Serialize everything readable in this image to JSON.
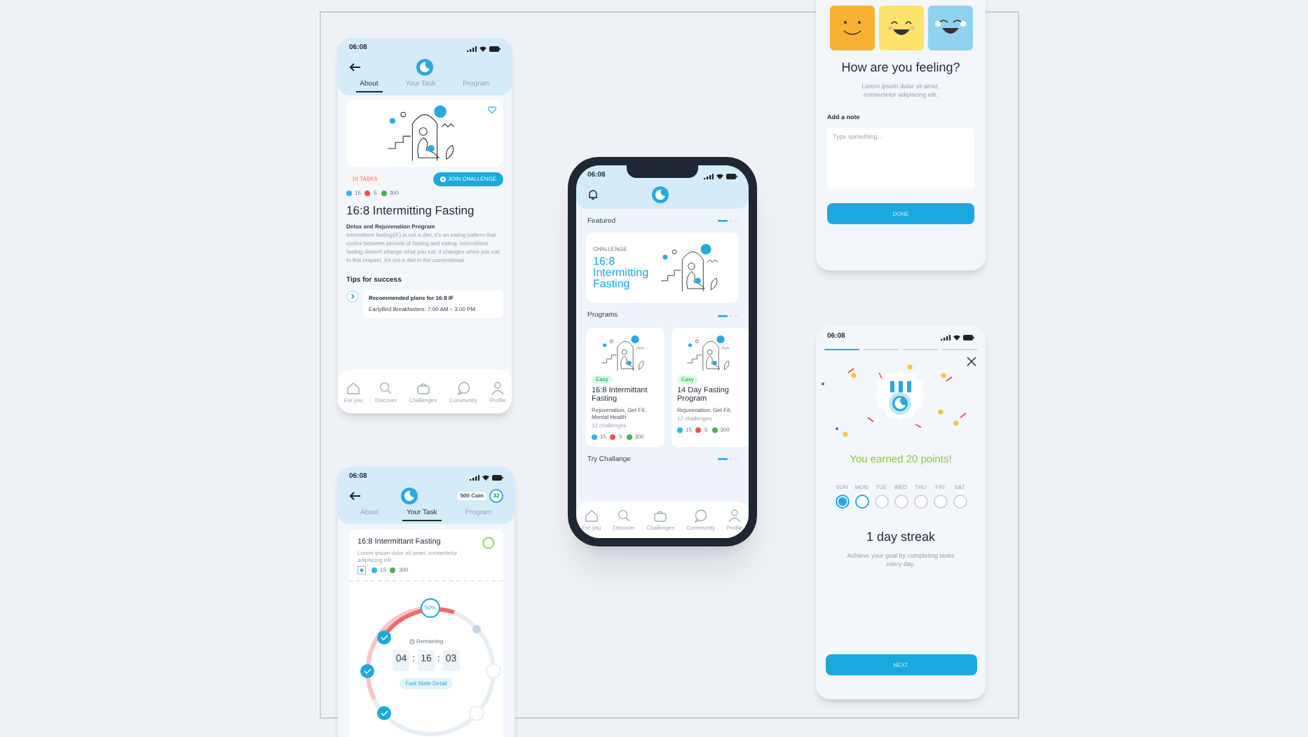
{
  "about_screen": {
    "time": "06:08",
    "tabs": [
      {
        "label": "About",
        "selected": true
      },
      {
        "label": "Your Task",
        "selected": false
      },
      {
        "label": "Program",
        "selected": false
      }
    ],
    "tag": "10 TASKS",
    "join_button": "JOIN CHALLENGE",
    "stats": [
      {
        "value": "15",
        "color": "#35b3e6"
      },
      {
        "value": "5",
        "color": "#ef5350"
      },
      {
        "value": "300",
        "color": "#4caf50"
      }
    ],
    "title": "16:8 Intermitting Fasting",
    "subtitle": "Detox and Rejuvenation Program",
    "description": [
      "Intermittent fasting(IF) is not a diet, it's an eating pattern that cycles between periods of fasting and eating. Intermittent fasting doesn't change what you eat, it changes when you eat.",
      "In this respect, it's not a diet in the conventional"
    ],
    "tips_heading": "Tips for success",
    "tip_title": "Recommended plans for 16:8 IF",
    "tip_line": "EarlyBird Breakfasters: 7:00 AM – 3:00 PM",
    "nav": [
      "For you",
      "Discover",
      "Challenges",
      "Community",
      "Profile"
    ]
  },
  "task_screen": {
    "time": "06:08",
    "coins": "500 Coin",
    "badge": "32",
    "tabs": [
      {
        "label": "About",
        "selected": false
      },
      {
        "label": "Your Task",
        "selected": true
      },
      {
        "label": "Program",
        "selected": false
      }
    ],
    "card_title": "16:8 Intermittant Fasting",
    "card_description": "Lorem ipsum dolor sit amet, consectetur adipiscing elit.",
    "stats": [
      {
        "value": "15",
        "color": "#35b3e6"
      },
      {
        "value": "300",
        "color": "#4caf50"
      }
    ],
    "progress_label": "50%",
    "remaining": "Remaining",
    "timer": [
      "04",
      "16",
      "03"
    ],
    "timer_separator": ":",
    "detail_button": "Fast State Detail"
  },
  "home_screen": {
    "time": "06:08",
    "featured_heading": "Featured",
    "featured_label": "CHALLENGE",
    "featured_title": "16:8 Intermitting Fasting",
    "programs_heading": "Programs",
    "programs": [
      {
        "tag": "Easy",
        "title": "16:8 Intermittant Fasting",
        "topics": "Rejuvenation, Get Fit, Mental Health",
        "count": "12 challenges",
        "stats": [
          {
            "value": "15",
            "color": "#35b3e6"
          },
          {
            "value": "5",
            "color": "#ef5350"
          },
          {
            "value": "300",
            "color": "#4caf50"
          }
        ]
      },
      {
        "tag": "Easy",
        "title": "14 Day Fasting Program",
        "topics": "Rejuvenation, Get Fit,",
        "count": "12 challenges",
        "stats": [
          {
            "value": "15",
            "color": "#35b3e6"
          },
          {
            "value": "5",
            "color": "#ef5350"
          },
          {
            "value": "300",
            "color": "#4caf50"
          }
        ]
      }
    ],
    "try_heading": "Try Challange",
    "nav": [
      "For you",
      "Discover",
      "Challenges",
      "Community",
      "Profile"
    ]
  },
  "mood_screen": {
    "faces": [
      {
        "kind": "smile",
        "color": "#f8b133"
      },
      {
        "kind": "grin",
        "color": "#fde36b"
      },
      {
        "kind": "laugh",
        "color": "#8fd3f0"
      }
    ],
    "title": "How are you feeling?",
    "description": "Lorem ipsum dolor sit amet, consectetur adipiscing elit.",
    "note_label": "Add a note",
    "note_placeholder": "Type something...",
    "button": "DONE"
  },
  "streak_screen": {
    "time": "06:08",
    "steps": [
      {
        "done": true
      },
      {
        "done": false
      },
      {
        "done": false
      },
      {
        "done": false
      }
    ],
    "points": "You earned 20 points!",
    "days": [
      {
        "label": "SUN",
        "done": true,
        "current": false
      },
      {
        "label": "MON",
        "done": false,
        "current": true
      },
      {
        "label": "TUE",
        "done": false,
        "current": false
      },
      {
        "label": "WED",
        "done": false,
        "current": false
      },
      {
        "label": "THU",
        "done": false,
        "current": false
      },
      {
        "label": "FRI",
        "done": false,
        "current": false
      },
      {
        "label": "SAT",
        "done": false,
        "current": false
      }
    ],
    "streak_title": "1 day streak",
    "description": "Achieve your goal by completing tasks every day.",
    "button": "NEXT"
  }
}
